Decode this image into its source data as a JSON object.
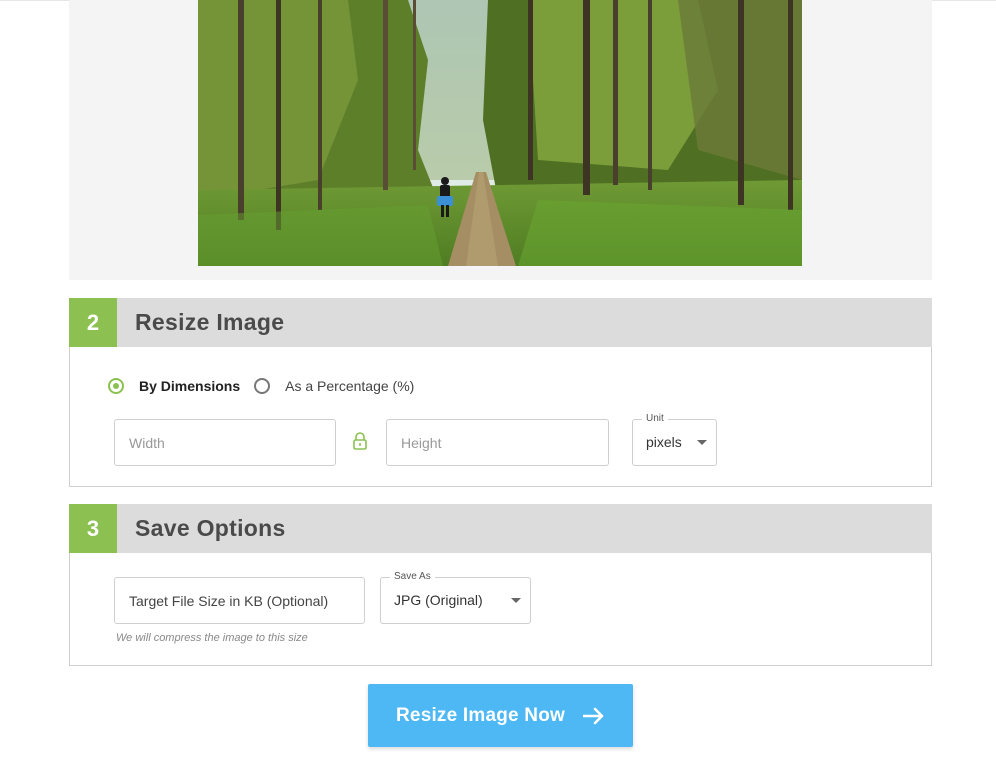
{
  "sections": {
    "resize": {
      "number": "2",
      "title": "Resize Image",
      "options": [
        {
          "label": "By Dimensions",
          "checked": true
        },
        {
          "label": "As a Percentage (%)",
          "checked": false
        }
      ],
      "width_placeholder": "Width",
      "height_placeholder": "Height",
      "unit_legend": "Unit",
      "unit_value": "pixels"
    },
    "save": {
      "number": "3",
      "title": "Save Options",
      "target_size_placeholder": "Target File Size in KB (Optional)",
      "hint": "We will compress the image to this size",
      "save_as_legend": "Save As",
      "save_as_value": "JPG (Original)"
    }
  },
  "cta": {
    "label": "Resize Image Now"
  },
  "icons": {
    "lock": "lock-icon",
    "arrow": "arrow-right-icon",
    "caret": "chevron-down-icon"
  },
  "colors": {
    "accent_green": "#8cc152",
    "cta_blue": "#4db8f3",
    "header_gray": "#dcdcdc"
  }
}
